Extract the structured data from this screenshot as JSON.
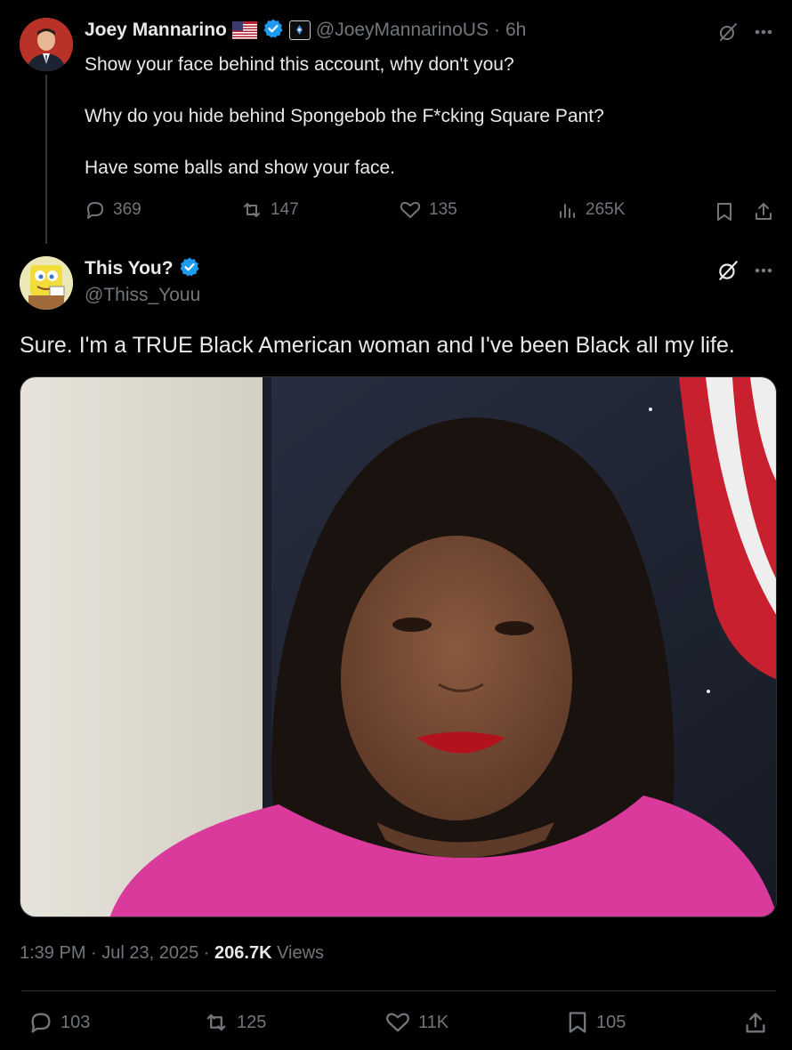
{
  "reply_parent": {
    "name": "Joey Mannarino",
    "flag": "🇺🇸",
    "handle": "@JoeyMannarinoUS",
    "separator": "·",
    "time": "6h",
    "text_lines": [
      "Show your face behind this account, why don't you?",
      "Why do you hide behind Spongebob the F*cking Square Pant?",
      "Have some balls and show your face."
    ],
    "replies": "369",
    "reposts": "147",
    "likes": "135",
    "views": "265K"
  },
  "main_tweet": {
    "name": "This You?",
    "handle": "@Thiss_Youu",
    "text": "Sure. I'm a TRUE Black American woman and I've been Black all my life.",
    "timestamp": "1:39 PM · Jul 23, 2025 · ",
    "view_count": "206.7K",
    "views_label": " Views",
    "replies": "103",
    "reposts": "125",
    "likes": "11K",
    "bookmarks": "105"
  },
  "colors": {
    "background": "#000000",
    "text": "#e7e9ea",
    "muted": "#71767b",
    "verified": "#1d9bf0",
    "divider": "#2f3336"
  },
  "icons": [
    "grok-icon",
    "more-icon",
    "reply-icon",
    "repost-icon",
    "like-icon",
    "views-icon",
    "bookmark-icon",
    "share-icon",
    "verified-badge-icon",
    "affiliate-badge-icon"
  ]
}
